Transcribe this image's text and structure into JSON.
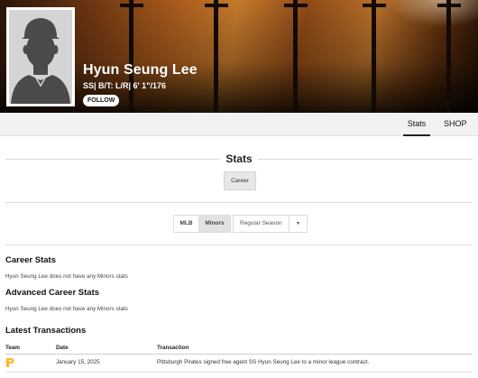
{
  "player": {
    "name": "Hyun Seung Lee",
    "bio": "SS| B/T: L/R| 6' 1\"/176",
    "follow_label": "FOLLOW"
  },
  "subnav": {
    "tabs": [
      {
        "label": "Stats",
        "active": true
      },
      {
        "label": "SHOP",
        "active": false
      }
    ]
  },
  "stats": {
    "heading": "Stats",
    "career_button": "Career",
    "league_toggle": [
      {
        "label": "MLB",
        "selected": false
      },
      {
        "label": "Minors",
        "selected": true
      }
    ],
    "season_select": {
      "value": "Regular Season"
    }
  },
  "career_stats": {
    "title": "Career Stats",
    "note": "Hyun Seung Lee does not have any Minors stats"
  },
  "advanced_stats": {
    "title": "Advanced Career Stats",
    "note": "Hyun Seung Lee does not have any Minors stats"
  },
  "transactions": {
    "title": "Latest Transactions",
    "columns": [
      "Team",
      "Date",
      "Transaction"
    ],
    "rows": [
      {
        "team_logo": "pittsburgh-pirates-p-logo",
        "date": "January 15, 2025",
        "text": "Pittsburgh Pirates signed free agent SS Hyun Seung Lee to a minor league contract."
      }
    ]
  },
  "colors": {
    "pirates_gold": "#FDB827",
    "active_tab_underline": "#222222"
  }
}
